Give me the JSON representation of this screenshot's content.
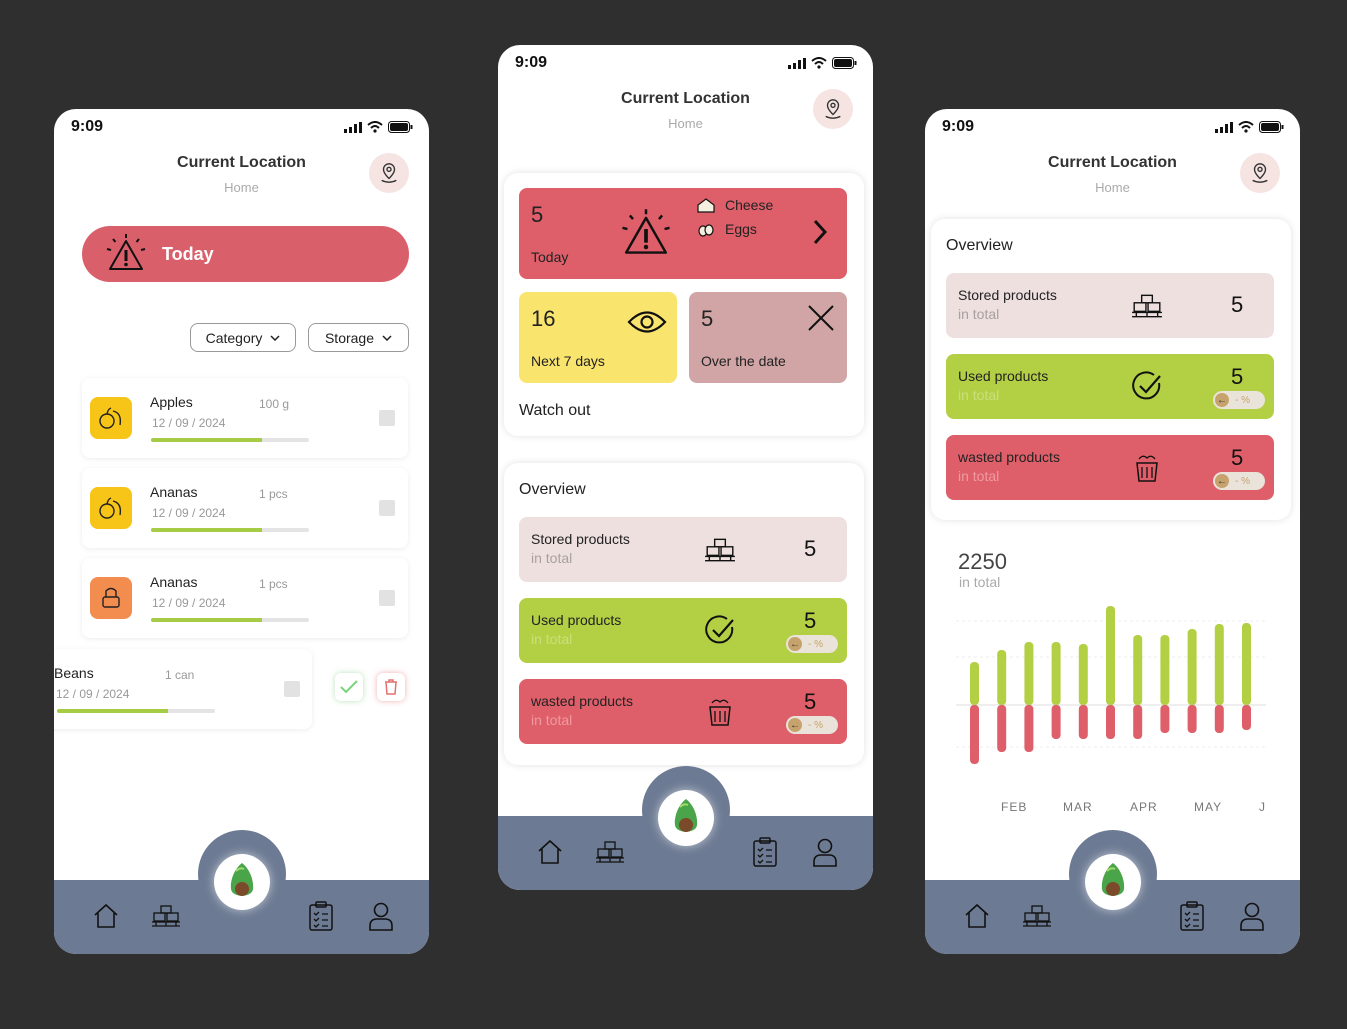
{
  "status": {
    "time": "9:09"
  },
  "header": {
    "title": "Current Location",
    "subtitle": "Home"
  },
  "left": {
    "today_label": "Today",
    "filters": [
      {
        "label": "Category"
      },
      {
        "label": "Storage"
      }
    ],
    "items": [
      {
        "name": "Apples",
        "qty": "100 g",
        "date": "12 / 09 / 2024",
        "progress": 0.7,
        "icon_color": "#f7c418",
        "icon": "fruits-icon"
      },
      {
        "name": "Ananas",
        "qty": "1 pcs",
        "date": "12 / 09 / 2024",
        "progress": 0.7,
        "icon_color": "#f7c418",
        "icon": "fruits-icon"
      },
      {
        "name": "Ananas",
        "qty": "1 pcs",
        "date": "12 / 09 / 2024",
        "progress": 0.7,
        "icon_color": "#f28d4f",
        "icon": "bakery-icon"
      }
    ],
    "swiped_item": {
      "name": "Beans",
      "qty": "1 can",
      "date": "12 / 09 / 2024",
      "progress": 0.7
    }
  },
  "mid": {
    "today_tile": {
      "count": "5",
      "label": "Today",
      "items": [
        "Cheese",
        "Eggs"
      ]
    },
    "next_tile": {
      "count": "16",
      "label": "Next 7 days"
    },
    "over_tile": {
      "count": "5",
      "label": "Over the date"
    },
    "watch_out_label": "Watch out",
    "overview_label": "Overview"
  },
  "overview": [
    {
      "name": "Stored products",
      "sub": "in total",
      "value": "5",
      "color": "#ede0df",
      "has_pill": false,
      "icon": "pallet-boxes-icon"
    },
    {
      "name": "Used products",
      "sub": "in total",
      "value": "5",
      "color": "#b3d045",
      "has_pill": true,
      "pill": "- %",
      "icon": "check-circle-icon"
    },
    {
      "name": "wasted products",
      "sub": "in total",
      "value": "5",
      "color": "#de5f69",
      "has_pill": true,
      "pill": "- %",
      "icon": "trash-bin-icon"
    }
  ],
  "right": {
    "overview_label": "Overview",
    "total_value": "2250",
    "total_label": "in total"
  },
  "chart_data": {
    "type": "bar",
    "categories": [
      "FEB",
      "MAR",
      "APR",
      "MAY",
      "J"
    ],
    "series": [
      {
        "values": [
          43,
          55,
          63,
          63,
          61,
          99,
          70,
          70,
          76,
          81,
          82
        ]
      },
      {
        "values": [
          -59,
          -47,
          -47,
          -34,
          -34,
          -34,
          -34,
          -28,
          -28,
          -28,
          -25
        ]
      }
    ],
    "colors": [
      "#b3d045",
      "#de5f69"
    ]
  }
}
